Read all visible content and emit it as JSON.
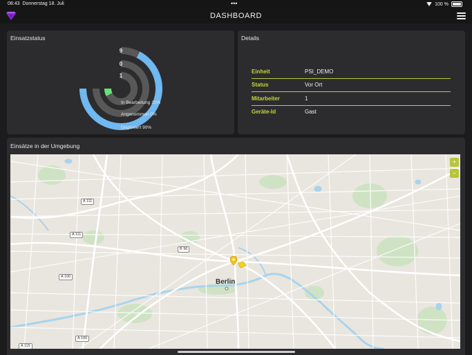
{
  "status_bar": {
    "time": "08:43",
    "date": "Donnerstag 18. Juli",
    "dots": "•••",
    "battery": "100 %"
  },
  "header": {
    "title": "DASHBOARD",
    "logo_color": "#8a2be2",
    "menu_icon": "hamburger-menu-icon"
  },
  "einsatzstatus": {
    "title": "Einsatzstatus",
    "rings": [
      {
        "count": "9",
        "label": "Disponiert 90%",
        "fraction": 0.9,
        "color": "#6fb8f0"
      },
      {
        "count": "0",
        "label": "Angenommen 0%",
        "fraction": 0.0,
        "color": "#6fb8f0"
      },
      {
        "count": "1",
        "label": "In Bearbeitung 10%",
        "fraction": 0.1,
        "color": "#66e07a"
      }
    ],
    "track_color": "#585858"
  },
  "details": {
    "title": "Details",
    "rows": [
      {
        "label": "Einheit",
        "value": "PSI_DEMO"
      },
      {
        "label": "Status",
        "value": "Vor Ort"
      },
      {
        "label": "Mitarbeiter",
        "value": "1"
      },
      {
        "label": "Geräte-Id",
        "value": "Gast"
      }
    ],
    "accent": "#c7d63a"
  },
  "map_section": {
    "title": "Einsätze in der Umgebung",
    "city": "Berlin",
    "zoom_in": "+",
    "zoom_out": "−",
    "road_labels": [
      "A 111",
      "A 111",
      "B 96",
      "A 100",
      "A 100",
      "A 115"
    ]
  }
}
